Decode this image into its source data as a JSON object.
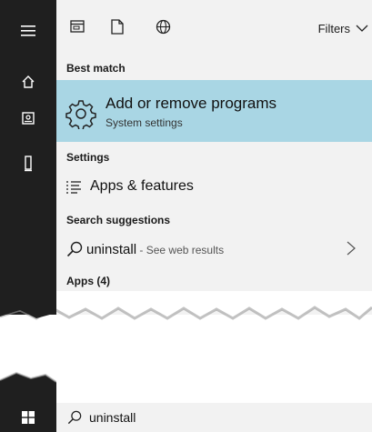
{
  "toolbar": {
    "filters_label": "Filters"
  },
  "sections": {
    "best_match": "Best match",
    "settings": "Settings",
    "search_suggestions": "Search suggestions",
    "apps": "Apps (4)"
  },
  "best_match": {
    "title": "Add or remove programs",
    "subtitle": "System settings"
  },
  "settings_items": [
    {
      "label": "Apps & features"
    }
  ],
  "suggestion": {
    "term": "uninstall",
    "hint": " - See web results"
  },
  "taskbar": {
    "query": "uninstall"
  },
  "colors": {
    "rail": "#1f1f1f",
    "panel": "#f2f2f2",
    "highlight": "#a9d6e4"
  }
}
